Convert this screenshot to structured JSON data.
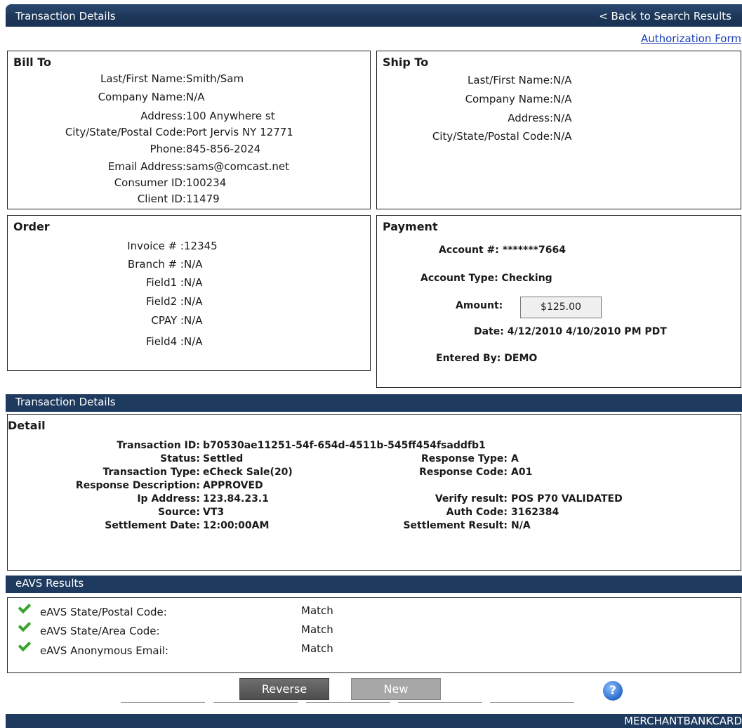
{
  "header": {
    "title": "Transaction Details",
    "back_link": "< Back to Search Results",
    "auth_link": "Authorization Form"
  },
  "bill_to": {
    "title": "Bill To",
    "rows": [
      {
        "label": "Last/First Name:",
        "value": "Smith/Sam"
      },
      {
        "label": "Company Name:",
        "value": "N/A"
      },
      {
        "label": "Address:",
        "value": "100 Anywhere st"
      },
      {
        "label": "City/State/Postal Code:",
        "value": "Port Jervis NY 12771"
      },
      {
        "label": "Phone:",
        "value": "845-856-2024"
      },
      {
        "label": "Email Address:",
        "value": "sams@comcast.net"
      },
      {
        "label": "Consumer ID:",
        "value": "100234"
      },
      {
        "label": "Client ID:",
        "value": "11479"
      }
    ]
  },
  "ship_to": {
    "title": "Ship To",
    "rows": [
      {
        "label": "Last/First Name:",
        "value": "N/A"
      },
      {
        "label": "Company Name:",
        "value": "N/A"
      },
      {
        "label": "Address:",
        "value": "N/A"
      },
      {
        "label": "City/State/Postal Code:",
        "value": "N/A"
      }
    ]
  },
  "order": {
    "title": "Order",
    "rows": [
      {
        "label": "Invoice # :",
        "value": "12345"
      },
      {
        "label": "Branch # :",
        "value": "N/A"
      },
      {
        "label": "Field1 :",
        "value": "N/A"
      },
      {
        "label": "Field2 :",
        "value": "N/A"
      },
      {
        "label": "CPAY :",
        "value": "N/A"
      },
      {
        "label": "Field4 :",
        "value": "N/A"
      }
    ]
  },
  "payment": {
    "title": "Payment",
    "account": "Account #: *******7664",
    "account_type": "Account Type: Checking",
    "amount_label": "Amount:",
    "amount_value": "$125.00",
    "date": "Date: 4/12/2010   4/10/2010 PM PDT",
    "entered_by": "Entered By: DEMO"
  },
  "detail_section": {
    "header": "Transaction Details",
    "title": "Detail",
    "transaction_id": {
      "label": "Transaction ID:",
      "value": "b70530ae11251-54f-654d-4511b-545ff454fsaddfb1"
    },
    "left": [
      {
        "label": "Status:",
        "value": "Settled"
      },
      {
        "label": "Transaction Type:",
        "value": "eCheck Sale(20)"
      },
      {
        "label": "Response Description:",
        "value": "APPROVED"
      },
      {
        "label": "Ip Address:",
        "value": "123.84.23.1"
      },
      {
        "label": "Source:",
        "value": "VT3"
      },
      {
        "label": "Settlement Date:",
        "value": "12:00:00AM"
      }
    ],
    "right": [
      {
        "label": "Response Type:",
        "value": "A"
      },
      {
        "label": "Response Code:",
        "value": "A01"
      },
      {
        "label": "Verify result:",
        "value": "POS P70 VALIDATED"
      },
      {
        "label": "Auth Code:",
        "value": "3162384"
      },
      {
        "label": "Settlement Result:",
        "value": "N/A"
      }
    ]
  },
  "eavs": {
    "header": "eAVS Results",
    "rows": [
      {
        "label": "eAVS State/Postal Code:",
        "value": "Match"
      },
      {
        "label": "eAVS State/Area Code:",
        "value": "Match"
      },
      {
        "label": "eAVS Anonymous Email:",
        "value": "Match"
      }
    ]
  },
  "buttons": {
    "reverse": "Reverse",
    "new": "New",
    "help": "?"
  },
  "footer": {
    "brand": "MERCHANTBANKCARD"
  }
}
